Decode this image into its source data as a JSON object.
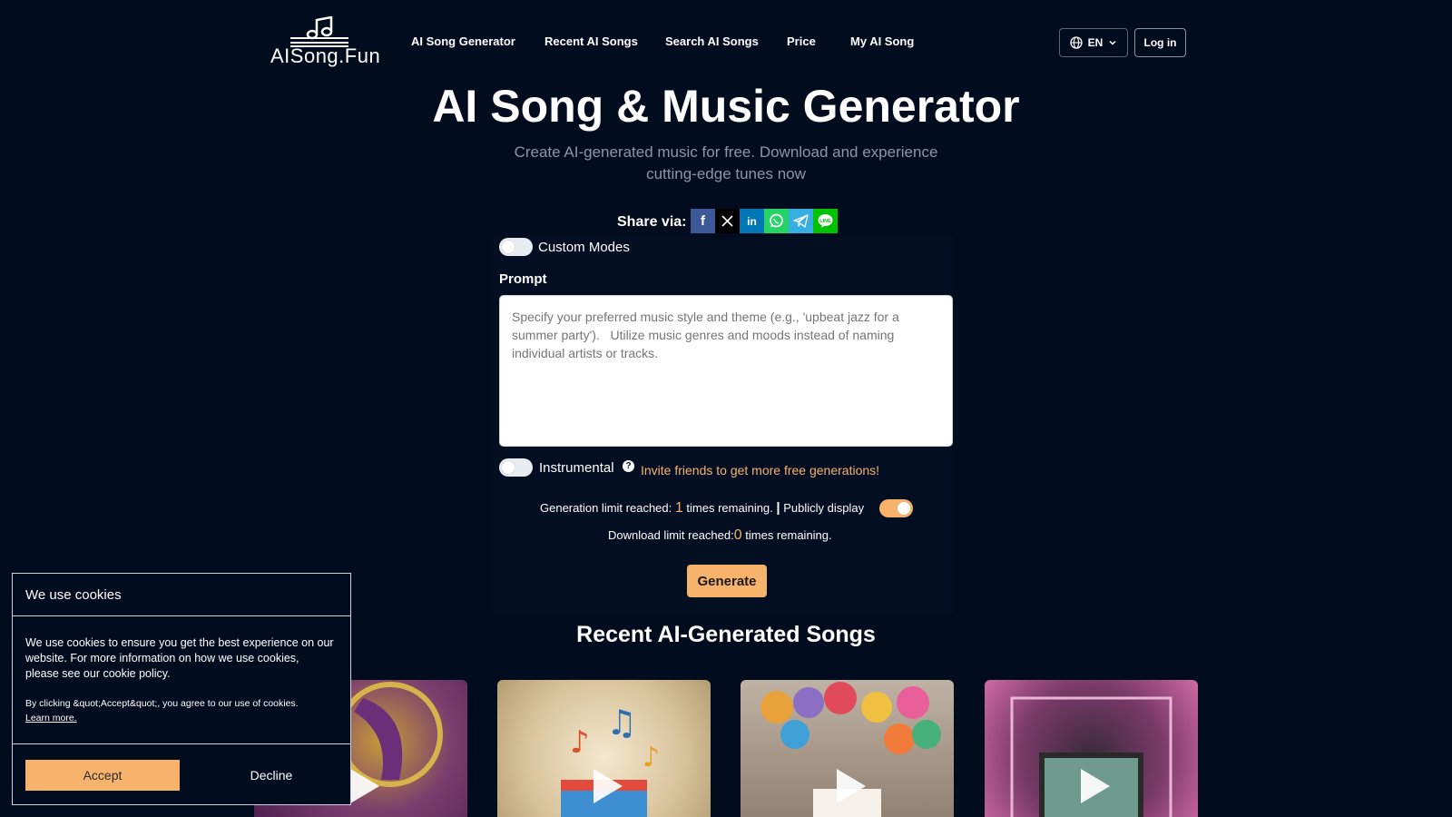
{
  "brand": {
    "logo_text": "AISong.Fun"
  },
  "nav": [
    {
      "label": "AI Song Generator"
    },
    {
      "label": "Recent AI Songs"
    },
    {
      "label": "Search AI Songs"
    },
    {
      "label": "Price"
    },
    {
      "label": "My AI Song"
    }
  ],
  "header": {
    "language": "EN",
    "login_label": "Log in",
    "language_icon": "globe-icon"
  },
  "hero": {
    "title": "AI Song & Music Generator",
    "subtitle": "Create AI-generated music for free. Download and experience cutting-edge tunes now"
  },
  "share": {
    "label": "Share via:",
    "buttons": [
      {
        "name": "facebook",
        "icon": "facebook-icon",
        "color": "#3b5998"
      },
      {
        "name": "x",
        "icon": "x-icon",
        "color": "#000000"
      },
      {
        "name": "linkedin",
        "icon": "linkedin-icon",
        "color": "#0077b5"
      },
      {
        "name": "whatsapp",
        "icon": "whatsapp-icon",
        "color": "#25d366"
      },
      {
        "name": "telegram",
        "icon": "telegram-icon",
        "color": "#37aee2"
      },
      {
        "name": "line",
        "icon": "line-icon",
        "color": "#00c300"
      }
    ]
  },
  "form": {
    "custom_modes_label": "Custom Modes",
    "custom_modes_on": false,
    "prompt_label": "Prompt",
    "prompt_placeholder": "Specify your preferred music style and theme (e.g., 'upbeat jazz for a summer party').   Utilize music genres and moods instead of naming individual artists or tracks.",
    "prompt_value": "",
    "instrumental_label": "Instrumental",
    "instrumental_on": false,
    "invite_text": "Invite friends to get more free generations!",
    "generation_prefix": "Generation limit reached:",
    "generation_remaining": "1",
    "generation_suffix": "times remaining.",
    "separator": "|",
    "public_label": "Publicly display",
    "public_on": true,
    "download_prefix": "Download limit reached:",
    "download_remaining": "0",
    "download_suffix": "times remaining.",
    "generate_label": "Generate"
  },
  "recent": {
    "title": "Recent AI-Generated Songs"
  },
  "cookie": {
    "title": "We use cookies",
    "body": "We use cookies to ensure you get the best experience on our website. For more information on how we use cookies, please see our cookie policy.",
    "small": "By clicking &quot;Accept&quot;, you agree to our use of cookies.",
    "learn_more": "Learn more.",
    "accept_label": "Accept",
    "decline_label": "Decline"
  },
  "colors": {
    "accent": "#f7b36c",
    "background": "#020c1f"
  }
}
